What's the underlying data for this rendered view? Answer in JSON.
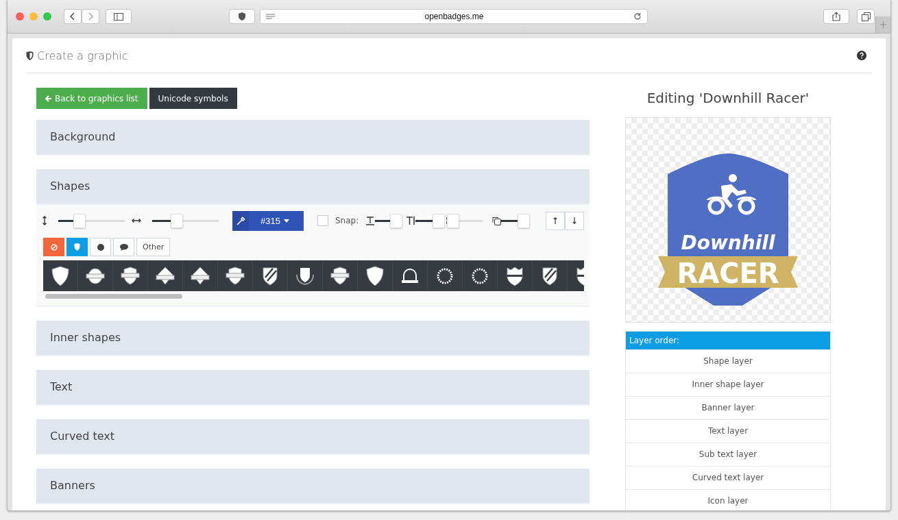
{
  "browser": {
    "url": "openbadges.me"
  },
  "page": {
    "title": "Create a graphic"
  },
  "buttons": [
    {
      "label": "Back to graphics list",
      "kind": "back"
    },
    {
      "label": "Unicode symbols",
      "kind": "dark"
    }
  ],
  "sections": [
    {
      "title": "Background",
      "kind": "collapsed"
    },
    {
      "title": "Shapes",
      "kind": "shapes"
    },
    {
      "title": "Inner shapes",
      "kind": "collapsed"
    },
    {
      "title": "Text",
      "kind": "collapsed"
    },
    {
      "title": "Curved text",
      "kind": "collapsed"
    },
    {
      "title": "Banners",
      "kind": "collapsed"
    }
  ],
  "shape_controls": {
    "height_slider": {
      "level": 0.32
    },
    "width_slider": {
      "level": 0.37
    },
    "color_button": {
      "label": "#315"
    },
    "snap": {
      "label": "Snap:",
      "checked": false
    },
    "sliders": [
      {
        "kind": "text-size",
        "level": 0.85
      },
      {
        "kind": "text-bold",
        "level": 0.95
      },
      {
        "kind": "curve",
        "level": 0.1
      },
      {
        "kind": "copy",
        "level": 0.9
      }
    ]
  },
  "categories": [
    {
      "kind": "none",
      "selected": false
    },
    {
      "kind": "shield",
      "selected": true
    },
    {
      "kind": "circle",
      "selected": false
    },
    {
      "kind": "speech",
      "selected": false
    },
    {
      "kind": "other",
      "label": "Other",
      "selected": false
    }
  ],
  "shape_tiles": [
    {
      "kind": "shield"
    },
    {
      "kind": "round-banner"
    },
    {
      "kind": "shield-banner"
    },
    {
      "kind": "diamond-banner"
    },
    {
      "kind": "diamond-banner"
    },
    {
      "kind": "shield-banner"
    },
    {
      "kind": "striped-shield"
    },
    {
      "kind": "wreath-shield"
    },
    {
      "kind": "shield-banner"
    },
    {
      "kind": "shield"
    },
    {
      "kind": "arch"
    },
    {
      "kind": "wreath"
    },
    {
      "kind": "wreath"
    },
    {
      "kind": "band-shield"
    },
    {
      "kind": "striped-shield"
    },
    {
      "kind": "band-shield"
    }
  ],
  "preview": {
    "title": "Editing 'Downhill Racer'",
    "badge_text": "Downhill",
    "banner_text": "RACER"
  },
  "layers": {
    "header": "Layer order:",
    "items": [
      "Shape layer",
      "Inner shape layer",
      "Banner layer",
      "Text layer",
      "Sub text layer",
      "Curved text layer",
      "Icon layer"
    ]
  }
}
